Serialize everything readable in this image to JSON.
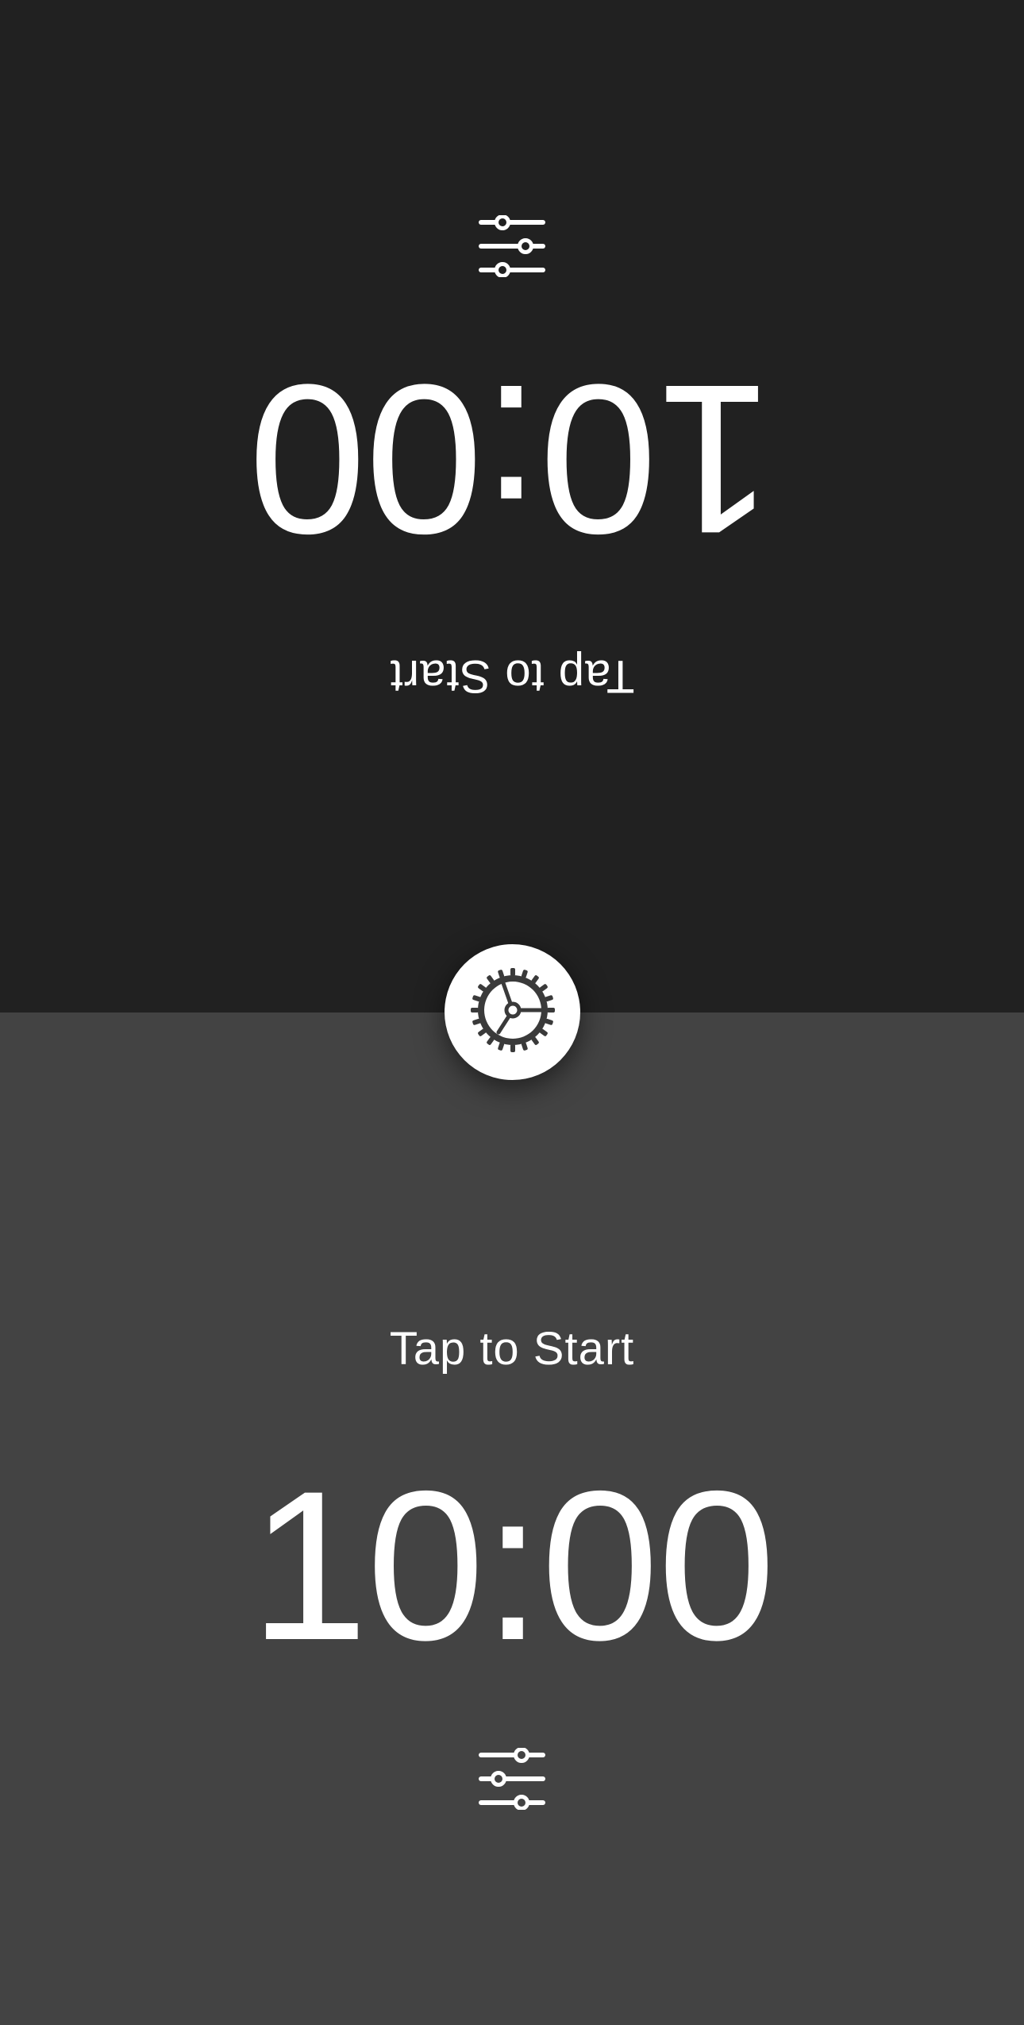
{
  "top_player": {
    "status_label": "Tap to Start",
    "time": "10:00",
    "settings_icon": "sliders-icon"
  },
  "bottom_player": {
    "status_label": "Tap to Start",
    "time": "10:00",
    "settings_icon": "sliders-icon"
  },
  "center_button": {
    "icon": "steering-wheel-icon"
  },
  "colors": {
    "top_background": "#212121",
    "bottom_background": "#434343",
    "text": "#ffffff",
    "center_button": "#ffffff"
  }
}
